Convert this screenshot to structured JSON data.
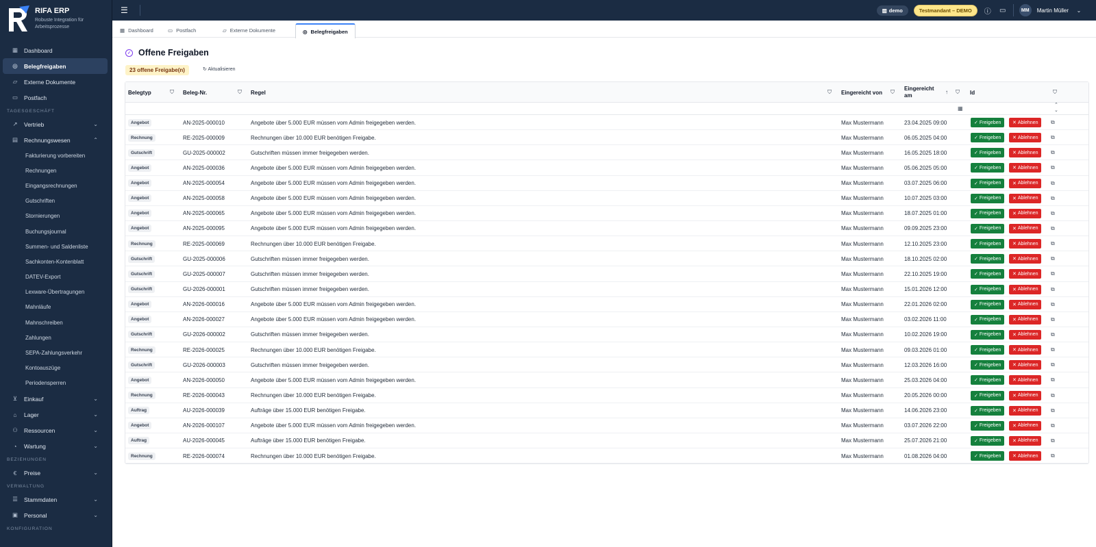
{
  "brand": {
    "name": "RIFA ERP",
    "tagline": "Robuste Integration für Arbeitsprozesse"
  },
  "sidebar": {
    "top_items": [
      {
        "label": "Dashboard",
        "icon": "dashboard-icon",
        "active": false
      },
      {
        "label": "Belegfreigaben",
        "icon": "check-circle-icon",
        "active": true
      },
      {
        "label": "Externe Dokumente",
        "icon": "folder-icon",
        "active": false
      },
      {
        "label": "Postfach",
        "icon": "inbox-icon",
        "active": false
      }
    ],
    "section_tagesgeschaeft": "TAGESGESCHÄFT",
    "vertrieb": "Vertrieb",
    "rechnungswesen": "Rechnungswesen",
    "rechnungswesen_items": [
      "Fakturierung vorbereiten",
      "Rechnungen",
      "Eingangsrechnungen",
      "Gutschriften",
      "Stornierungen",
      "Buchungsjournal",
      "Summen- und Saldenliste",
      "Sachkonten-Kontenblatt",
      "DATEV-Export",
      "Lexware-Übertragungen",
      "Mahnläufe",
      "Mahnschreiben",
      "Zahlungen",
      "SEPA-Zahlungsverkehr",
      "Kontoauszüge",
      "Periodensperren"
    ],
    "einkauf": "Einkauf",
    "lager": "Lager",
    "ressourcen": "Ressourcen",
    "wartung": "Wartung",
    "section_beziehungen": "BEZIEHUNGEN",
    "preise": "Preise",
    "section_verwaltung": "VERWALTUNG",
    "stammdaten": "Stammdaten",
    "personal": "Personal",
    "section_konfiguration": "KONFIGURATION"
  },
  "topbar": {
    "tenant": "demo",
    "badge": "Testmandant – DEMO",
    "avatar_initials": "MM",
    "user": "Martin Müller"
  },
  "tabs": [
    "Dashboard",
    "Postfach",
    "Externe Dokumente",
    "Belegfreigaben"
  ],
  "page": {
    "title": "Offene Freigaben",
    "count": "23 offene Freigabe(n)",
    "refresh": "Aktualisieren"
  },
  "table": {
    "headers": {
      "belegtyp": "Belegtyp",
      "belegnr": "Beleg-Nr.",
      "regel": "Regel",
      "von": "Eingereicht von",
      "am": "Eingereicht am",
      "id": "Id"
    },
    "approve_label": "Freigeben",
    "reject_label": "Ablehnen",
    "rows": [
      [
        "Angebot",
        "AN-2025-000010",
        "Angebote über 5.000 EUR müssen vom Admin freigegeben werden.",
        "Max Mustermann",
        "23.04.2025 09:00"
      ],
      [
        "Rechnung",
        "RE-2025-000009",
        "Rechnungen über 10.000 EUR benötigen Freigabe.",
        "Max Mustermann",
        "06.05.2025 04:00"
      ],
      [
        "Gutschrift",
        "GU-2025-000002",
        "Gutschriften müssen immer freigegeben werden.",
        "Max Mustermann",
        "16.05.2025 18:00"
      ],
      [
        "Angebot",
        "AN-2025-000036",
        "Angebote über 5.000 EUR müssen vom Admin freigegeben werden.",
        "Max Mustermann",
        "05.06.2025 05:00"
      ],
      [
        "Angebot",
        "AN-2025-000054",
        "Angebote über 5.000 EUR müssen vom Admin freigegeben werden.",
        "Max Mustermann",
        "03.07.2025 06:00"
      ],
      [
        "Angebot",
        "AN-2025-000058",
        "Angebote über 5.000 EUR müssen vom Admin freigegeben werden.",
        "Max Mustermann",
        "10.07.2025 03:00"
      ],
      [
        "Angebot",
        "AN-2025-000065",
        "Angebote über 5.000 EUR müssen vom Admin freigegeben werden.",
        "Max Mustermann",
        "18.07.2025 01:00"
      ],
      [
        "Angebot",
        "AN-2025-000095",
        "Angebote über 5.000 EUR müssen vom Admin freigegeben werden.",
        "Max Mustermann",
        "09.09.2025 23:00"
      ],
      [
        "Rechnung",
        "RE-2025-000069",
        "Rechnungen über 10.000 EUR benötigen Freigabe.",
        "Max Mustermann",
        "12.10.2025 23:00"
      ],
      [
        "Gutschrift",
        "GU-2025-000006",
        "Gutschriften müssen immer freigegeben werden.",
        "Max Mustermann",
        "18.10.2025 02:00"
      ],
      [
        "Gutschrift",
        "GU-2025-000007",
        "Gutschriften müssen immer freigegeben werden.",
        "Max Mustermann",
        "22.10.2025 19:00"
      ],
      [
        "Gutschrift",
        "GU-2026-000001",
        "Gutschriften müssen immer freigegeben werden.",
        "Max Mustermann",
        "15.01.2026 12:00"
      ],
      [
        "Angebot",
        "AN-2026-000016",
        "Angebote über 5.000 EUR müssen vom Admin freigegeben werden.",
        "Max Mustermann",
        "22.01.2026 02:00"
      ],
      [
        "Angebot",
        "AN-2026-000027",
        "Angebote über 5.000 EUR müssen vom Admin freigegeben werden.",
        "Max Mustermann",
        "03.02.2026 11:00"
      ],
      [
        "Gutschrift",
        "GU-2026-000002",
        "Gutschriften müssen immer freigegeben werden.",
        "Max Mustermann",
        "10.02.2026 19:00"
      ],
      [
        "Rechnung",
        "RE-2026-000025",
        "Rechnungen über 10.000 EUR benötigen Freigabe.",
        "Max Mustermann",
        "09.03.2026 01:00"
      ],
      [
        "Gutschrift",
        "GU-2026-000003",
        "Gutschriften müssen immer freigegeben werden.",
        "Max Mustermann",
        "12.03.2026 16:00"
      ],
      [
        "Angebot",
        "AN-2026-000050",
        "Angebote über 5.000 EUR müssen vom Admin freigegeben werden.",
        "Max Mustermann",
        "25.03.2026 04:00"
      ],
      [
        "Rechnung",
        "RE-2026-000043",
        "Rechnungen über 10.000 EUR benötigen Freigabe.",
        "Max Mustermann",
        "20.05.2026 00:00"
      ],
      [
        "Auftrag",
        "AU-2026-000039",
        "Aufträge über 15.000 EUR benötigen Freigabe.",
        "Max Mustermann",
        "14.06.2026 23:00"
      ],
      [
        "Angebot",
        "AN-2026-000107",
        "Angebote über 5.000 EUR müssen vom Admin freigegeben werden.",
        "Max Mustermann",
        "03.07.2026 22:00"
      ],
      [
        "Auftrag",
        "AU-2026-000045",
        "Aufträge über 15.000 EUR benötigen Freigabe.",
        "Max Mustermann",
        "25.07.2026 21:00"
      ],
      [
        "Rechnung",
        "RE-2026-000074",
        "Rechnungen über 10.000 EUR benötigen Freigabe.",
        "Max Mustermann",
        "01.08.2026 04:00"
      ]
    ]
  }
}
